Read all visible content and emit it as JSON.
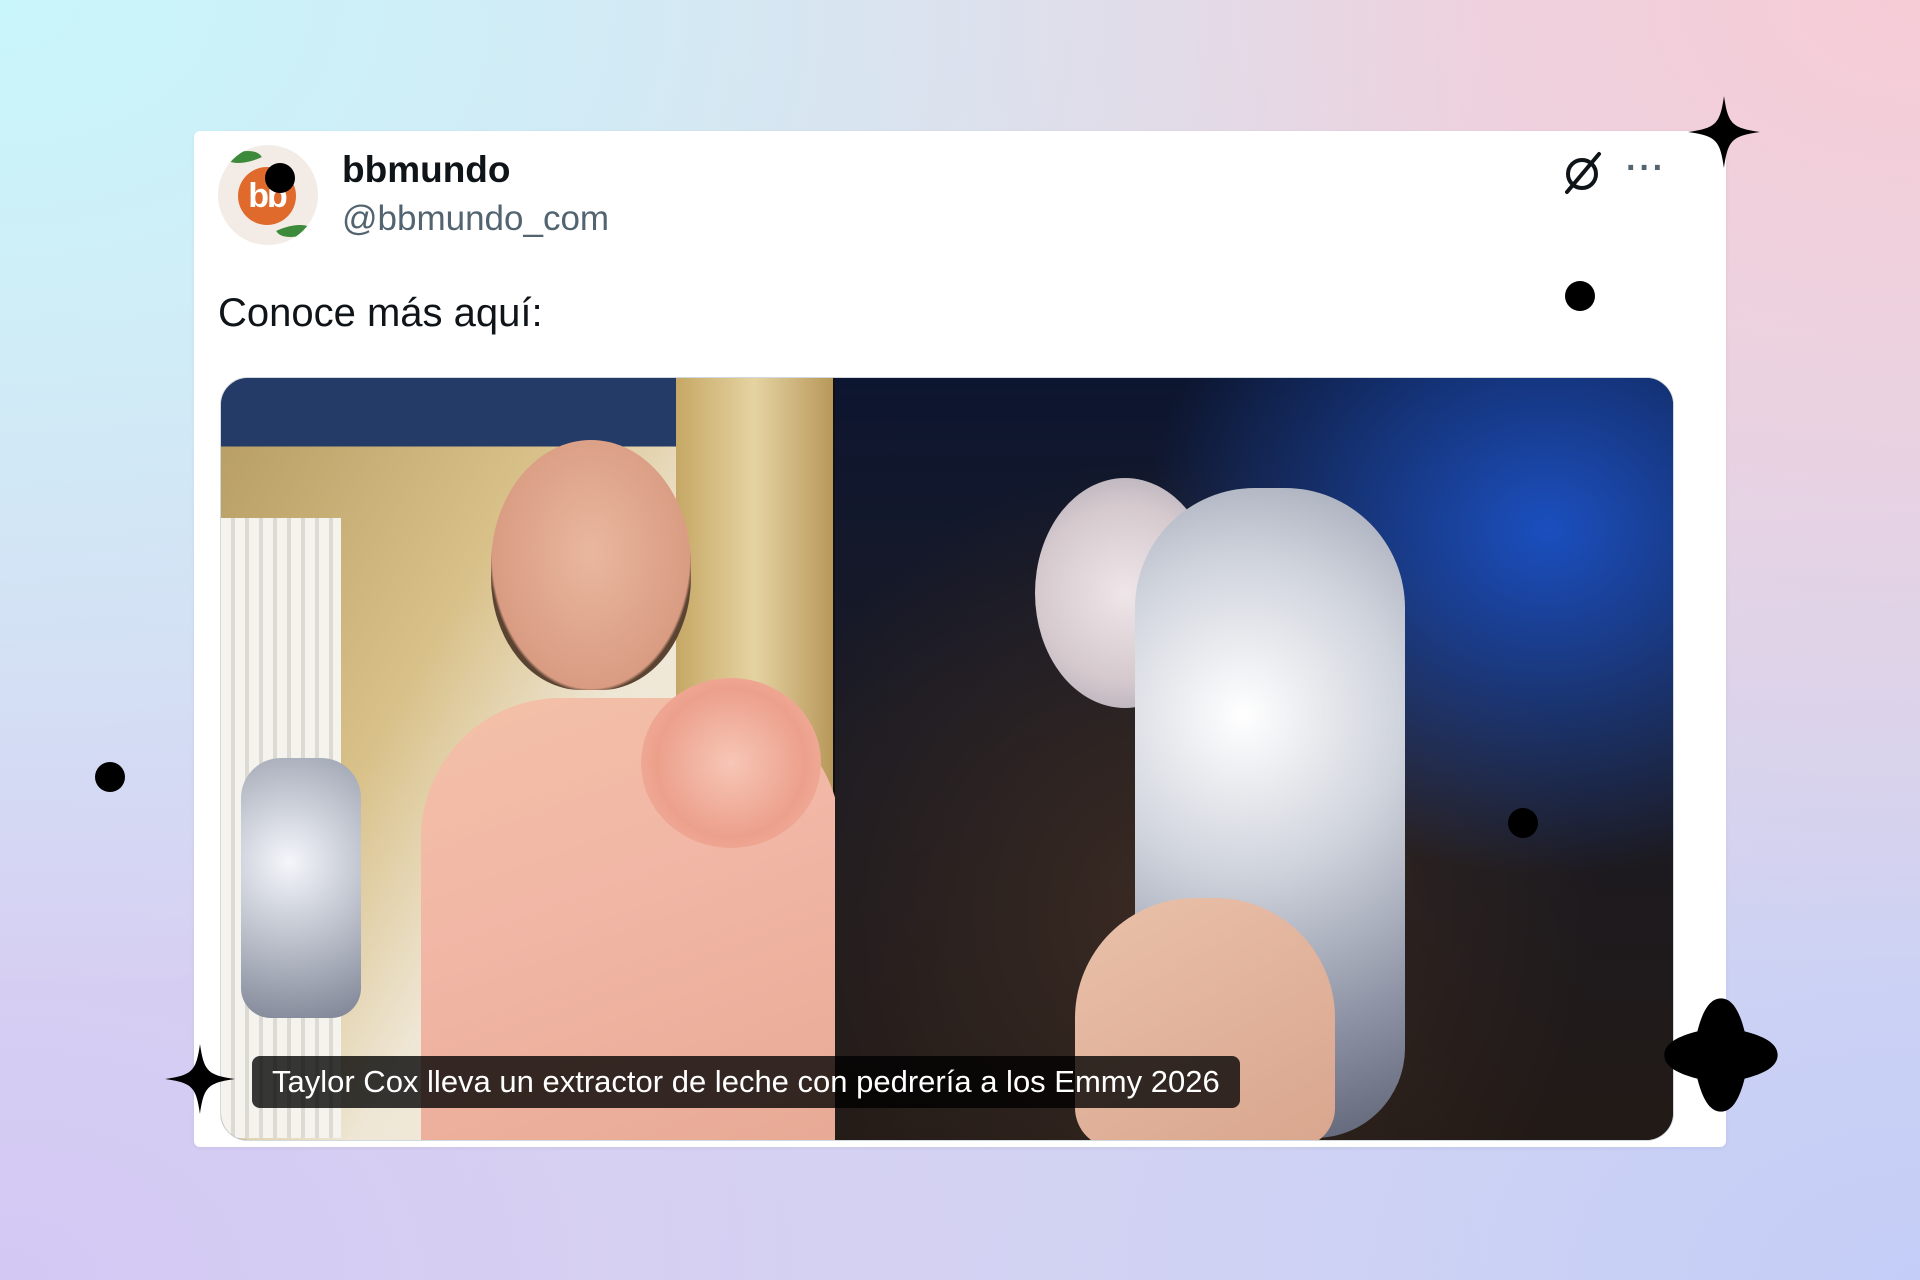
{
  "post": {
    "display_name": "bbmundo",
    "handle": "@bbmundo_com",
    "avatar_text": "bb",
    "text": "Conoce más aquí:",
    "media_caption": "Taylor Cox lleva un extractor de leche con pedrería a los Emmy 2026"
  },
  "icons": {
    "grok": "grok-icon",
    "more": "more-icon",
    "more_glyph": "···"
  },
  "colors": {
    "avatar_orange": "#e06a2c",
    "name_color": "#0f1419",
    "handle_color": "#536471"
  }
}
